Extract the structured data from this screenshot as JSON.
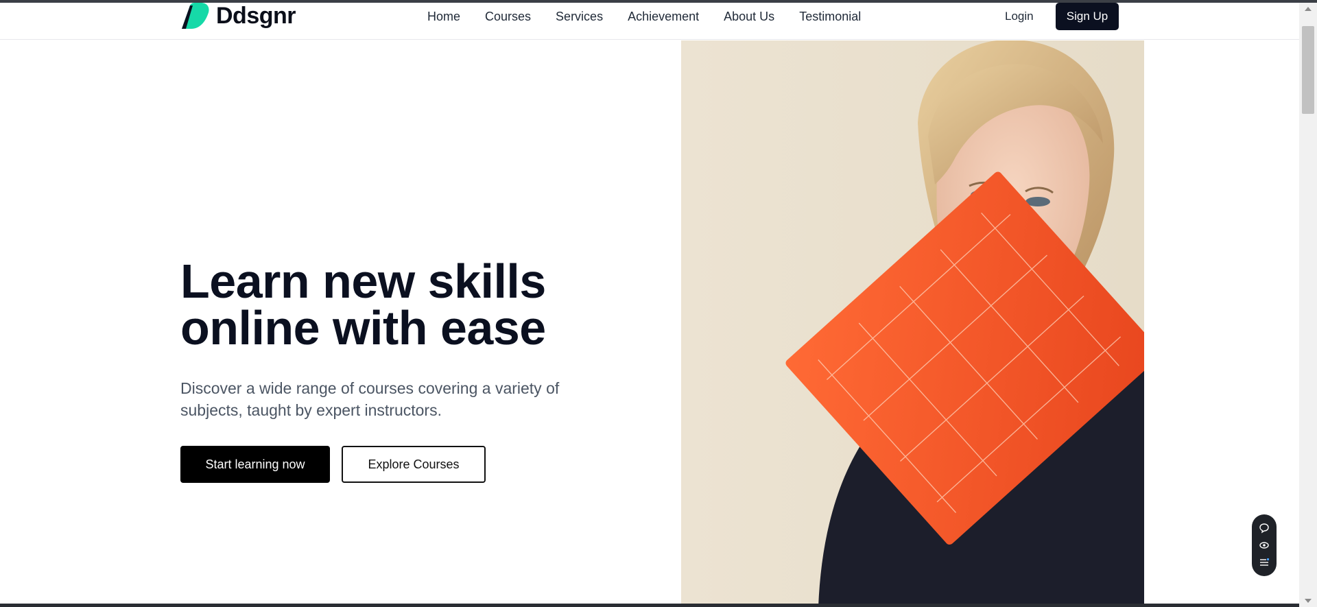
{
  "brand": {
    "name": "Ddsgnr",
    "accent": "#16d9a8"
  },
  "nav": {
    "links": [
      "Home",
      "Courses",
      "Services",
      "Achievement",
      "About Us",
      "Testimonial"
    ],
    "login": "Login",
    "signup": "Sign Up"
  },
  "hero": {
    "title_line1": "Learn new skills",
    "title_line2": "online with ease",
    "subtitle": "Discover a wide range of courses covering a variety of subjects, taught by expert instructors.",
    "primary_cta": "Start learning now",
    "secondary_cta": "Explore Courses"
  },
  "floating_tools": [
    "chat-icon",
    "eye-icon",
    "list-icon"
  ],
  "colors": {
    "dark": "#0b1020",
    "folder_orange": "#f15a2b",
    "image_bg": "#ece3d2"
  }
}
